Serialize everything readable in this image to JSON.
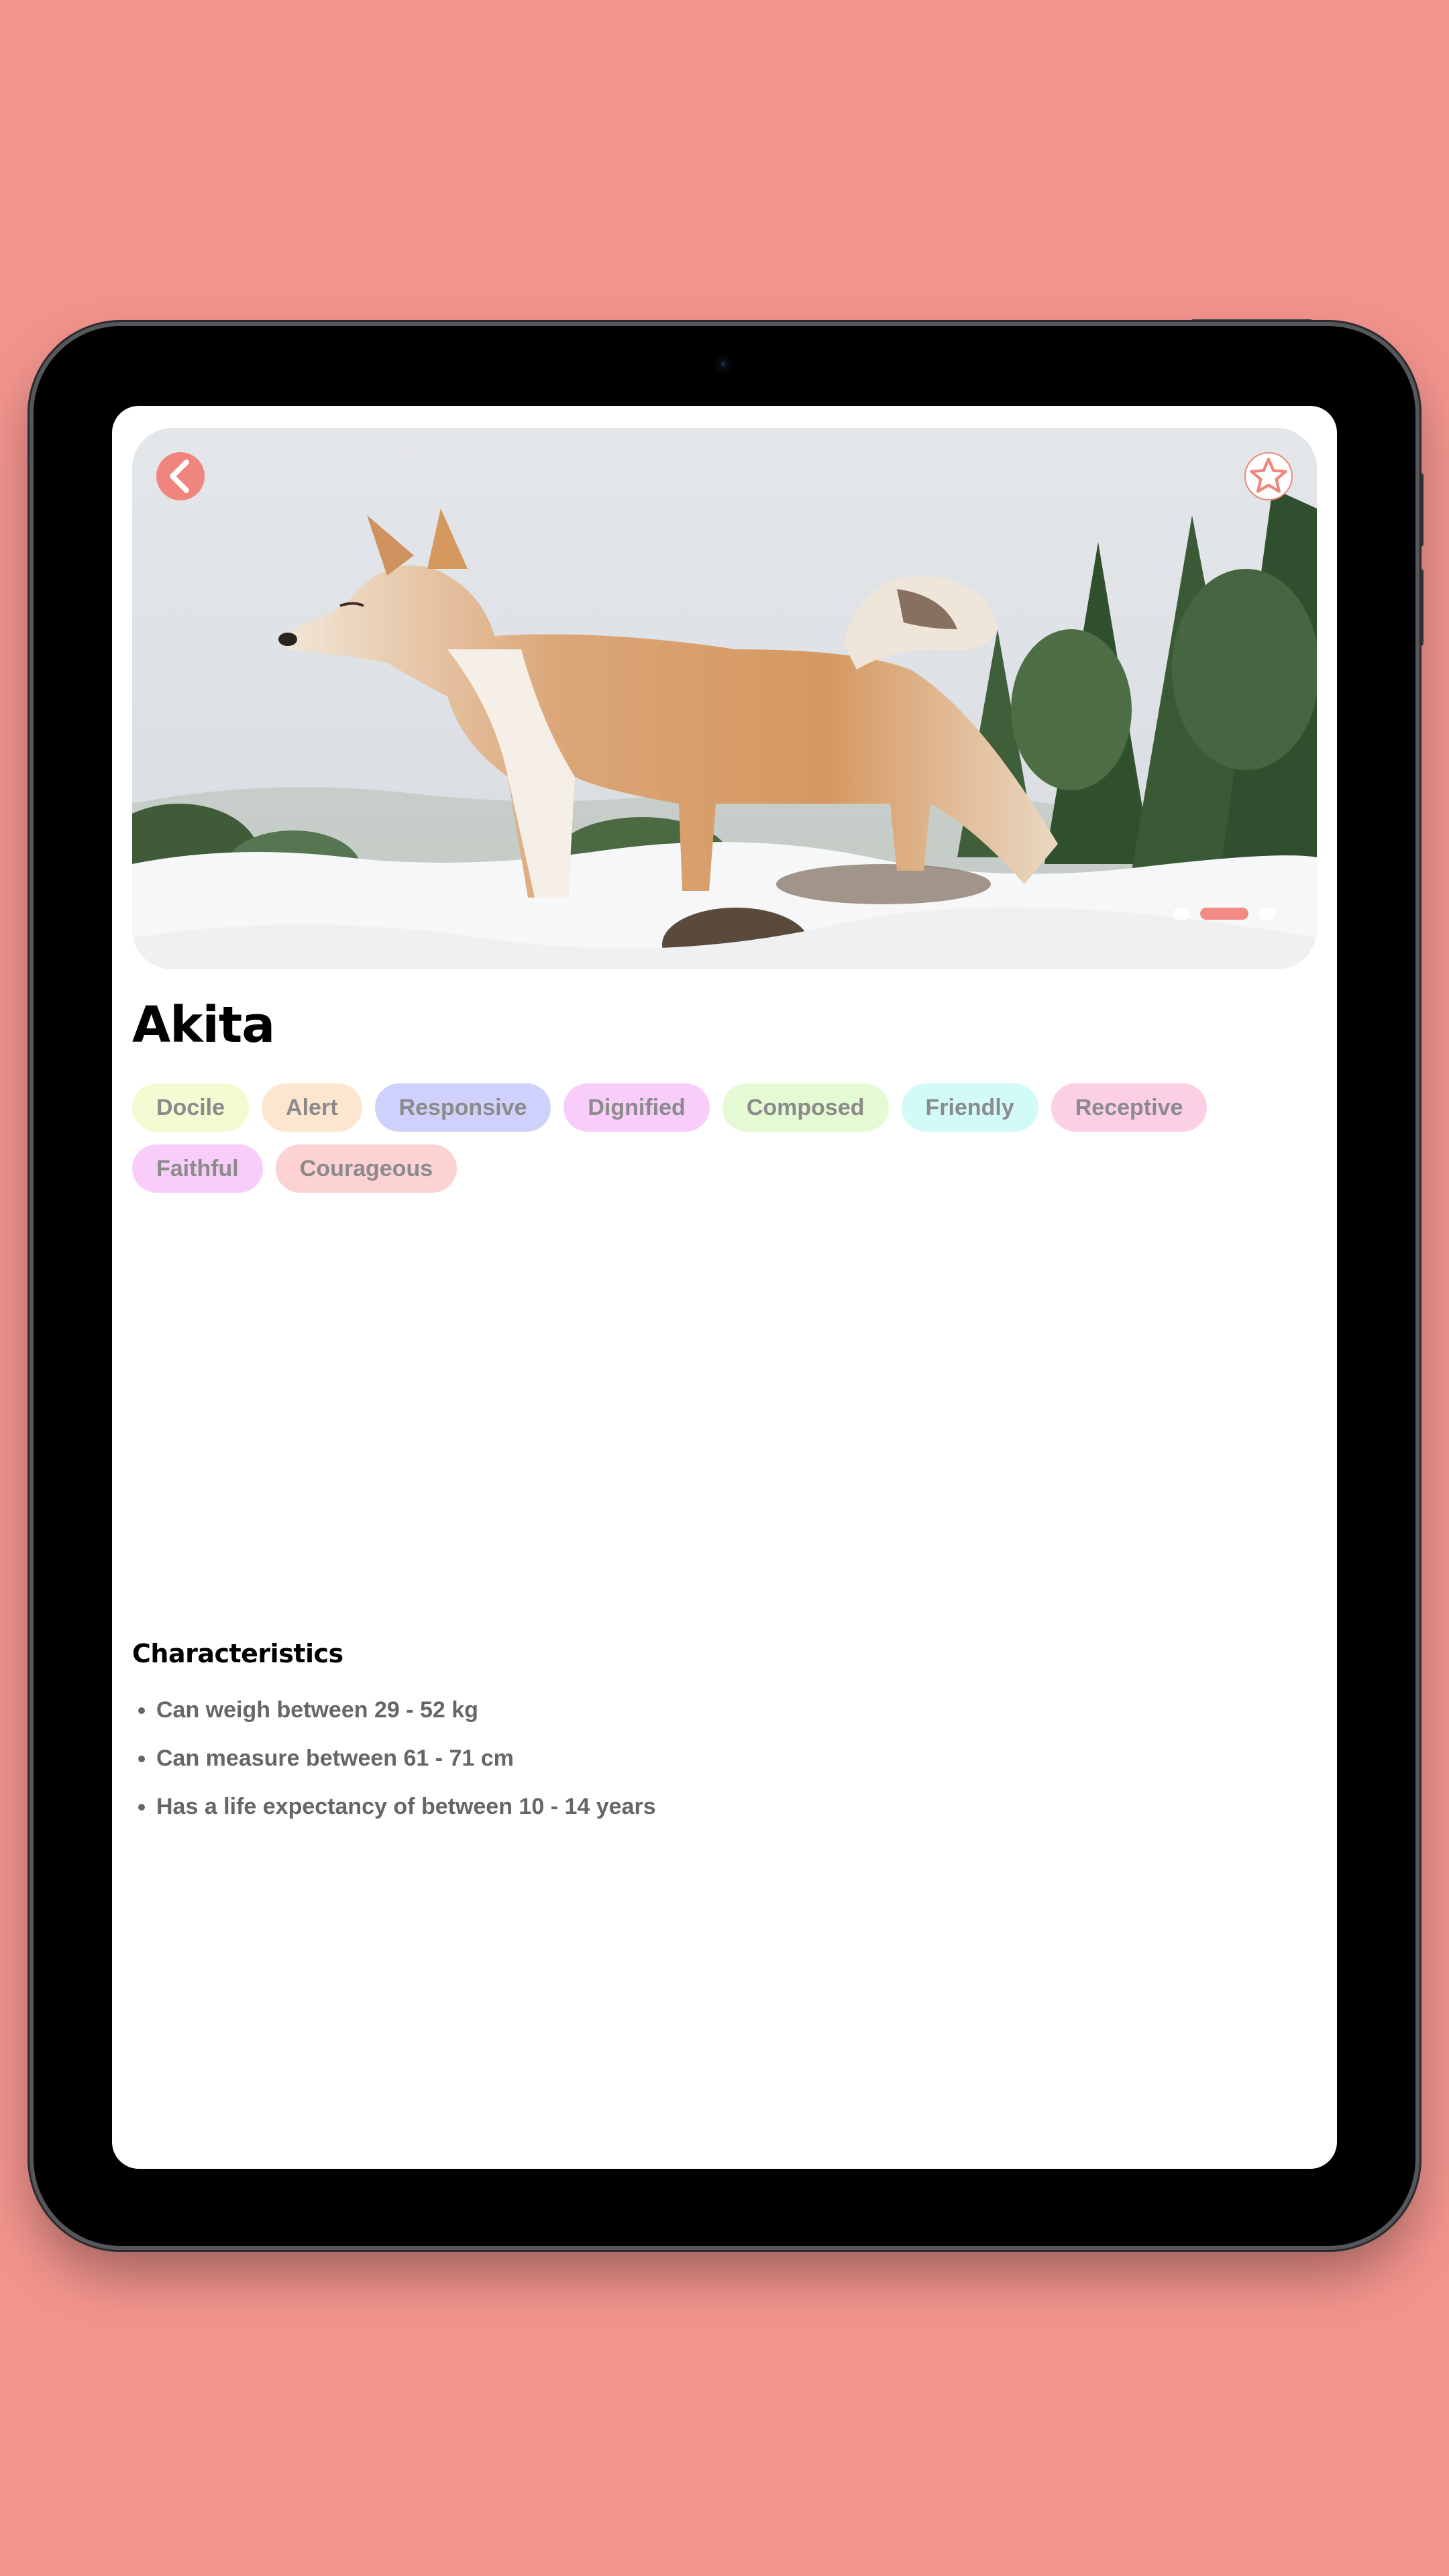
{
  "app": {
    "breed_name": "Akita",
    "accent_color": "#f0857d",
    "background_color": "#f2948d"
  },
  "hero": {
    "image_subject": "akita dog standing in snow",
    "back_button_icon": "chevron-left-icon",
    "favorite_button_icon": "star-outline-icon",
    "carousel_dot_count": 3,
    "carousel_active_index": 1
  },
  "tags": [
    {
      "label": "Docile",
      "color": "#f4fad2"
    },
    {
      "label": "Alert",
      "color": "#fde6cf"
    },
    {
      "label": "Responsive",
      "color": "#cfd0fb"
    },
    {
      "label": "Dignified",
      "color": "#f8cdfa"
    },
    {
      "label": "Composed",
      "color": "#e3fad4"
    },
    {
      "label": "Friendly",
      "color": "#d2fbf8"
    },
    {
      "label": "Receptive",
      "color": "#fccfe4"
    },
    {
      "label": "Faithful",
      "color": "#f8cdf9"
    },
    {
      "label": "Courageous",
      "color": "#fcd2d3"
    }
  ],
  "characteristics": {
    "heading": "Characteristics",
    "items": [
      "Can weigh between 29 - 52 kg",
      "Can measure between 61 - 71 cm",
      "Has a life expectancy of between 10 - 14 years"
    ]
  }
}
